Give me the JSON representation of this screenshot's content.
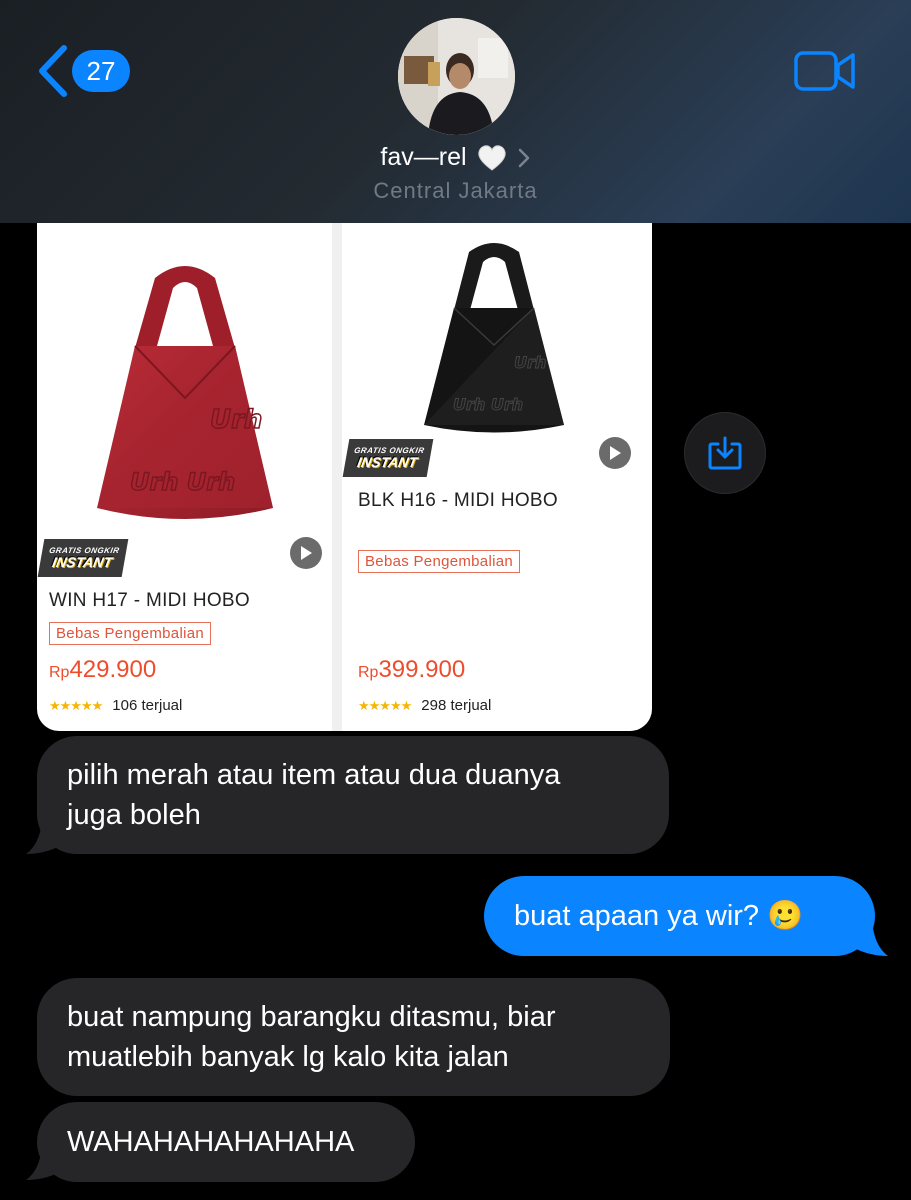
{
  "header": {
    "unread_count": "27",
    "contact_name": "fav—rel",
    "location": "Central Jakarta"
  },
  "icons": {
    "back": "chevron-left-icon",
    "heart": "white-heart-icon",
    "disclosure": "chevron-right-icon",
    "video": "video-camera-icon",
    "download": "download-tray-icon",
    "play": "play-icon",
    "emoji": "crying-face-emoji"
  },
  "products": [
    {
      "badge_top": "GRATIS ONGKIR",
      "badge_bottom": "INSTANT",
      "title": "WIN H17 - MIDI HOBO",
      "return_label": "Bebas Pengembalian",
      "currency": "Rp",
      "price": "429.900",
      "rating_stars": 5,
      "sold": "106 terjual",
      "bag_color": "#a8232e"
    },
    {
      "badge_top": "GRATIS ONGKIR",
      "badge_bottom": "INSTANT",
      "title": "BLK H16 - MIDI HOBO",
      "return_label": "Bebas Pengembalian",
      "currency": "Rp",
      "price": "399.900",
      "rating_stars": 5,
      "sold": "298 terjual",
      "bag_color": "#141414"
    }
  ],
  "messages": [
    {
      "direction": "incoming",
      "lines": [
        "pilih merah atau item atau dua duanya",
        "juga boleh"
      ]
    },
    {
      "direction": "outgoing",
      "text": "buat apaan ya wir?",
      "emoji": "🥲"
    },
    {
      "direction": "incoming",
      "lines": [
        "buat nampung barangku ditasmu, biar",
        "muatlebih banyak lg kalo kita jalan"
      ]
    },
    {
      "direction": "incoming",
      "lines": [
        "WAHAHAHAHAHAHA"
      ]
    }
  ],
  "colors": {
    "accent_blue": "#0a84ff",
    "incoming_bubble": "#262628",
    "price_orange": "#ee4d2d"
  }
}
